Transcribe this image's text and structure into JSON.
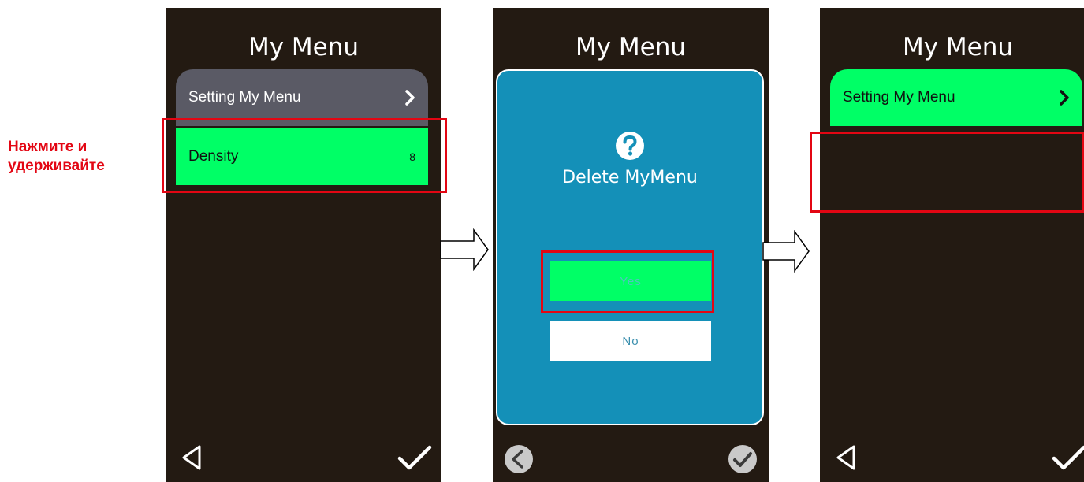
{
  "caption": {
    "line1": "Нажмите и",
    "line2": "удерживайте"
  },
  "screens": [
    {
      "title": "My Menu",
      "items": [
        {
          "label": "Setting My Menu",
          "icon": "chevron-right-icon"
        },
        {
          "label": "Density",
          "value": "8"
        }
      ],
      "nav": {
        "left_icon": "back-triangle-icon",
        "right_icon": "checkmark-icon"
      }
    },
    {
      "title": "My Menu",
      "dialog": {
        "icon": "question-icon",
        "message": "Delete MyMenu",
        "yes_label": "Yes",
        "no_label": "No"
      },
      "nav": {
        "left_icon": "back-circle-icon",
        "right_icon": "check-circle-icon"
      }
    },
    {
      "title": "My Menu",
      "items": [
        {
          "label": "Setting My Menu",
          "icon": "chevron-right-icon"
        }
      ],
      "nav": {
        "left_icon": "back-triangle-icon",
        "right_icon": "checkmark-icon"
      }
    }
  ],
  "colors": {
    "screen_bg": "#231a12",
    "accent_green": "#00ff66",
    "menu_grey": "#5a5a65",
    "dialog_blue": "#1490b8",
    "highlight_red": "#e30613"
  }
}
